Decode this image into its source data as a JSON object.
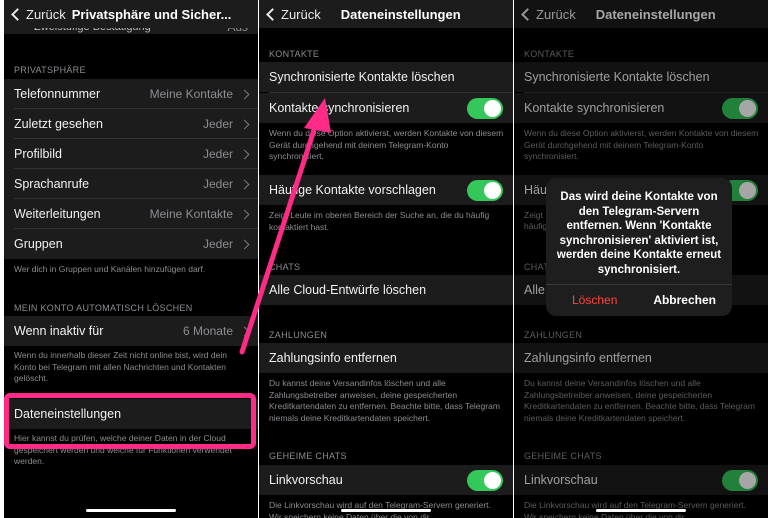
{
  "panel1": {
    "back_label": "Zurück",
    "title": "Privatsphäre und Sicher...",
    "top_partial_label": "Zweistufige Bestätigung",
    "top_partial_value": "Aus",
    "privacy_header": "PRIVATSPHÄRE",
    "privacy_rows": [
      {
        "label": "Telefonnummer",
        "value": "Meine Kontakte"
      },
      {
        "label": "Zuletzt gesehen",
        "value": "Jeder"
      },
      {
        "label": "Profilbild",
        "value": "Jeder"
      },
      {
        "label": "Sprachanrufe",
        "value": "Jeder"
      },
      {
        "label": "Weiterleitungen",
        "value": "Meine Kontakte"
      },
      {
        "label": "Gruppen",
        "value": "Jeder"
      }
    ],
    "privacy_footer": "Wer dich in Gruppen und Kanälen hinzufügen darf.",
    "delete_header": "MEIN KONTO AUTOMATISCH LÖSCHEN",
    "inactive_label": "Wenn inaktiv für",
    "inactive_value": "6 Monate",
    "delete_footer": "Wenn du innerhalb dieser Zeit nicht online bist, wird dein Konto bei Telegram mit allen Nachrichten und Kontakten gelöscht.",
    "data_settings_label": "Dateneinstellungen",
    "data_settings_footer": "Hier kannst du prüfen, welche deiner Daten in der Cloud gespeichert werden und welche für Funktionen verwendet werden."
  },
  "panel2": {
    "back_label": "Zurück",
    "title": "Dateneinstellungen",
    "contacts_header": "KONTAKTE",
    "delete_synced": "Synchronisierte Kontakte löschen",
    "sync_contacts": "Kontakte synchronisieren",
    "sync_footer": "Wenn du diese Option aktivierst, werden Kontakte von diesem Gerät durchgehend mit deinem Telegram-Konto synchronisiert.",
    "suggest_contacts": "Häufige Kontakte vorschlagen",
    "suggest_footer": "Zeigt Leute im oberen Bereich der Suche an, die du häufig kontaktiert hast.",
    "chats_header": "CHATS",
    "delete_drafts": "Alle Cloud-Entwürfe löschen",
    "payments_header": "ZAHLUNGEN",
    "remove_payment": "Zahlungsinfo entfernen",
    "payments_footer": "Du kannst deine Versandinfos löschen und alle Zahlungsbetreiber anweisen, deine gespeicherten Kreditkartendaten zu entfernen. Beachte bitte, dass Telegram niemals deine Kreditkartendaten speichert.",
    "secret_header": "GEHEIME CHATS",
    "link_preview": "Linkvorschau",
    "link_footer": "Die Linkvorschau wird auf den Telegram-Servern generiert. Wir speichern keine Daten über die von dir"
  },
  "panel3": {
    "back_label": "Zurück",
    "title": "Dateneinstellungen",
    "contacts_header": "KONTAKTE",
    "delete_synced": "Synchronisierte Kontakte löschen",
    "sync_contacts": "Kontakte synchronisieren",
    "sync_footer": "Wenn du diese Option aktivierst, werden Kontakte von diesem Gerät durchgehend mit deinem Telegram-Konto synchronisiert.",
    "suggest_partial": "Häufi",
    "suggest_footer_partial": "Zeigt L",
    "suggest_footer_partial2": "häufig k",
    "chats_header_partial": "CHATS",
    "delete_drafts_partial": "Alle C",
    "payments_header": "ZAHLUNGEN",
    "remove_payment": "Zahlungsinfo entfernen",
    "payments_footer": "Du kannst deine Versandinfos löschen und alle Zahlungsbetreiber anweisen, deine gespeicherten Kreditkartendaten zu entfernen. Beachte bitte, dass Telegram niemals deine Kreditkartendaten speichert.",
    "secret_header": "GEHEIME CHATS",
    "link_preview": "Linkvorschau",
    "link_footer": "Die Linkvorschau wird auf den Telegram-Servern generiert. Wir speichern keine Daten über die von dir"
  },
  "alert": {
    "message": "Das wird deine Kontakte von den Telegram-Servern entfernen. Wenn 'Kontakte synchronisieren' aktiviert ist, werden deine Kontakte erneut synchronisiert.",
    "delete_label": "Löschen",
    "cancel_label": "Abbrechen"
  },
  "colors": {
    "toggle_on": "#34c759",
    "destructive": "#ff453a",
    "highlight": "#ff2b86"
  }
}
